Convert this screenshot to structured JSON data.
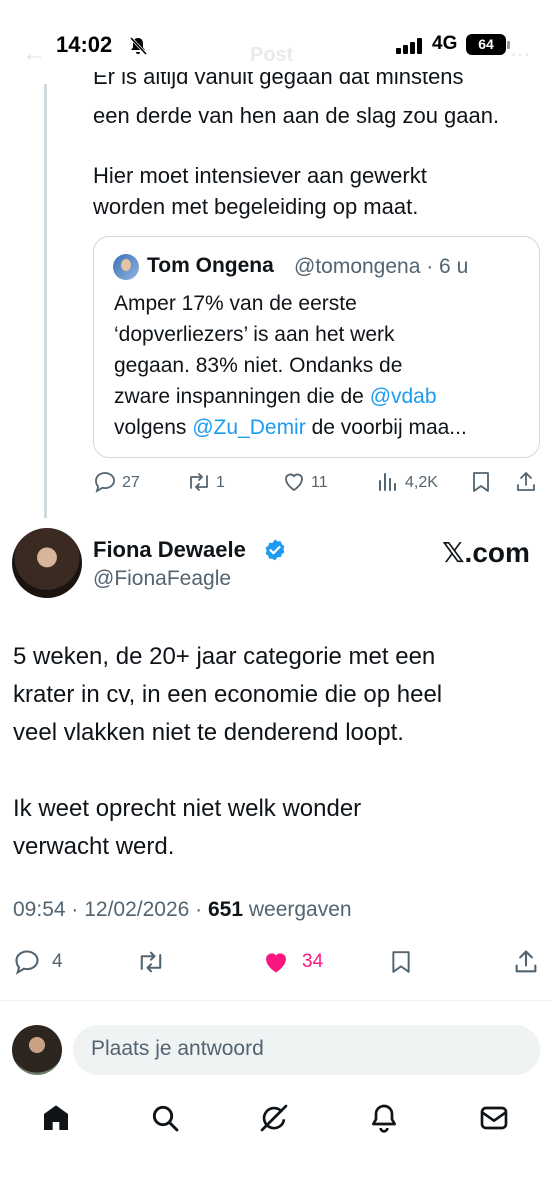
{
  "status_bar": {
    "time": "14:02",
    "network": "4G",
    "battery": "64"
  },
  "header": {
    "title": "Post"
  },
  "parent_post": {
    "cut_line": "Er is altijd vanuit gegaan dat minstens",
    "line2": "een derde van hen aan de slag zou gaan.",
    "para2_line1": "Hier moet intensiever aan gewerkt",
    "para2_line2": "worden met begeleiding op maat.",
    "quote": {
      "name": "Tom Ongena",
      "handle": "@tomongena · 6 u",
      "line1": "Amper 17% van de eerste",
      "line2": "‘dopverliezers’ is aan het werk",
      "line3": "gegaan. 83% niet. Ondanks de",
      "line4_pre": "zware inspanningen die de ",
      "line4_link": "@vdab",
      "line5_pre": "volgens ",
      "line5_link": "@Zu_Demir",
      "line5_post": " de voorbij maa..."
    },
    "actions": {
      "replies": "27",
      "reposts": "1",
      "likes": "11",
      "views": "4,2K"
    }
  },
  "post": {
    "name": "Fiona Dewaele",
    "handle": "@FionaFeagle",
    "source": "𝕏.com",
    "lines": [
      "5 weken, de 20+ jaar categorie met een",
      "krater in cv, in een economie die op heel",
      "veel vlakken niet te denderend loopt.",
      "",
      "Ik weet oprecht niet welk wonder",
      "verwacht werd."
    ],
    "timestamp": "09:54 · 12/02/2026 · ",
    "views_count": "651",
    "views_label": " weergaven",
    "actions": {
      "replies": "4",
      "likes": "34"
    }
  },
  "reply": {
    "placeholder": "Plaats je antwoord"
  },
  "colors": {
    "accent": "#1d9bf0",
    "like": "#f91880",
    "text": "#0f1419",
    "muted": "#536471"
  },
  "icons": [
    "reply-icon",
    "repost-icon",
    "like-icon",
    "views-icon",
    "bookmark-icon",
    "share-icon",
    "home-icon",
    "search-icon",
    "grok-icon",
    "notifications-icon",
    "messages-icon"
  ]
}
